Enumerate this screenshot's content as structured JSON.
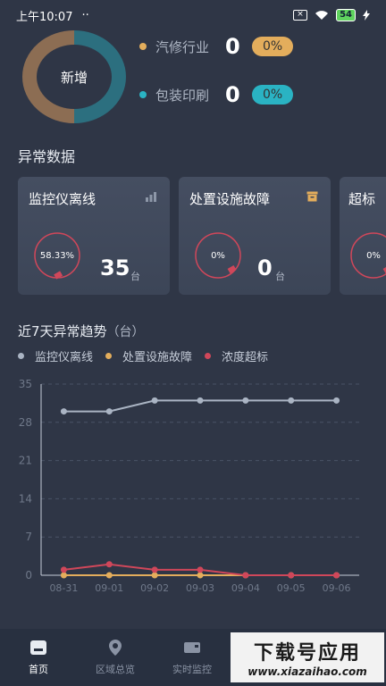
{
  "status_bar": {
    "time": "上午10:07",
    "dots": "··",
    "battery": "54"
  },
  "summary": {
    "center_label": "新增",
    "items": [
      {
        "name": "汽修行业",
        "count": "0",
        "pct": "0%",
        "color": "#e3ad5c"
      },
      {
        "name": "包装印刷",
        "count": "0",
        "pct": "0%",
        "color": "#2ab3c3"
      }
    ],
    "donut_colors": [
      "#8c6d53",
      "#2c6f7f"
    ]
  },
  "abnormal": {
    "title": "异常数据",
    "cards": [
      {
        "title": "监控仪离线",
        "pct": "58.33%",
        "num": "35",
        "unit": "台",
        "fraction": 0.5833,
        "icon": "bar-chart-icon"
      },
      {
        "title": "处置设施故障",
        "pct": "0%",
        "num": "0",
        "unit": "台",
        "fraction": 0,
        "icon": "box-icon"
      },
      {
        "title": "超标",
        "pct": "0%",
        "num": "",
        "unit": "",
        "fraction": 0,
        "icon": ""
      }
    ]
  },
  "trend": {
    "title": "近7天异常趋势",
    "unit": "（台）"
  },
  "chart_data": {
    "type": "line",
    "x": [
      "08-31",
      "09-01",
      "09-02",
      "09-03",
      "09-04",
      "09-05",
      "09-06"
    ],
    "y_ticks": [
      "0",
      "7",
      "14",
      "21",
      "28",
      "35"
    ],
    "ylim": [
      0,
      35
    ],
    "grid": true,
    "legend_position": "top-left",
    "series": [
      {
        "name": "监控仪离线",
        "color": "#aab4c3",
        "values": [
          30,
          30,
          32,
          32,
          32,
          32,
          32
        ]
      },
      {
        "name": "处置设施故障",
        "color": "#e3ad5c",
        "values": [
          0,
          0,
          0,
          0,
          0,
          0,
          0
        ]
      },
      {
        "name": "浓度超标",
        "color": "#d0475a",
        "values": [
          1,
          2,
          1,
          1,
          0,
          0,
          0
        ]
      }
    ]
  },
  "tabs": [
    {
      "label": "首页",
      "icon": "home-icon",
      "active": true
    },
    {
      "label": "区域总览",
      "icon": "location-icon",
      "active": false
    },
    {
      "label": "实时监控",
      "icon": "monitor-icon",
      "active": false
    }
  ],
  "watermark": {
    "line1": "下载号应用",
    "line2": "www.xiazaihao.com"
  }
}
